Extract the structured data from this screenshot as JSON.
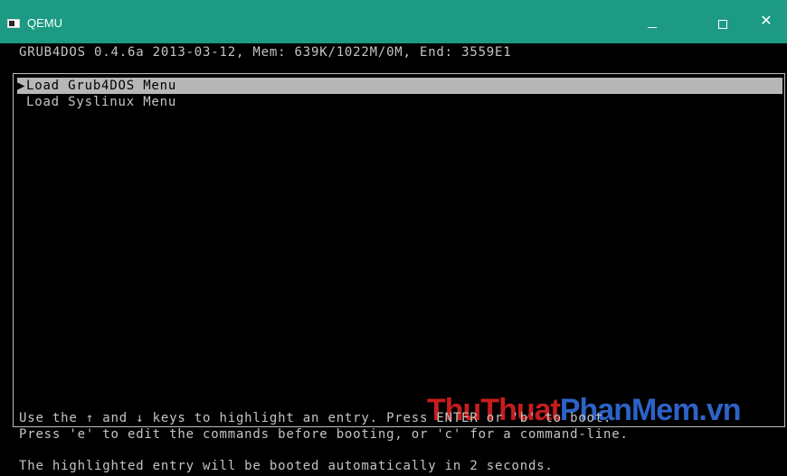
{
  "window": {
    "title": "QEMU",
    "minimize_symbol": "–",
    "maximize_symbol": "□",
    "close_symbol": "✕"
  },
  "screen": {
    "header": "GRUB4DOS 0.4.6a 2013-03-12, Mem: 639K/1022M/0M, End: 3559E1",
    "menu": {
      "selection_marker": "▶",
      "entries": [
        {
          "label": "Load Grub4DOS Menu",
          "selected": true
        },
        {
          "label": "Load Syslinux Menu",
          "selected": false
        }
      ]
    },
    "help_line_1": "Use the ↑ and ↓ keys to highlight an entry. Press ENTER or 'b' to boot.",
    "help_line_2": "Press 'e' to edit the commands before booting, or 'c' for a command-line.",
    "countdown": "The highlighted entry will be booted automatically in 2 seconds."
  },
  "watermark": {
    "part1": "ThuThuat",
    "part2": "PhanMem.vn"
  },
  "colors": {
    "titlebar": "#1c9a84",
    "screen_bg": "#000000",
    "text": "#c4c4c4",
    "selection_bg": "#b7b7b7",
    "watermark_red": "#c41d1d",
    "watermark_blue": "#2d63c8"
  }
}
